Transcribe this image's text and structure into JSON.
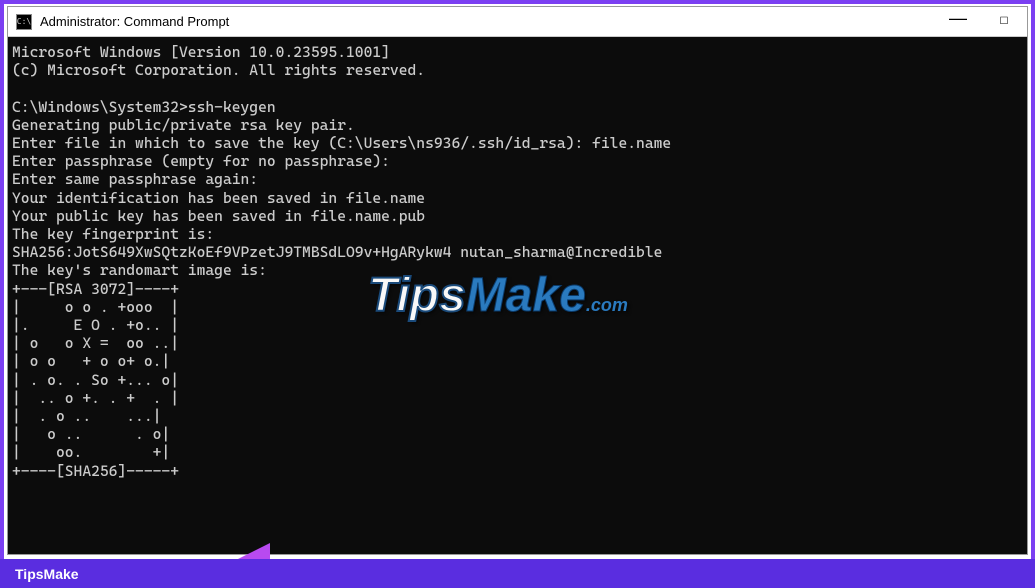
{
  "window": {
    "title": "Administrator: Command Prompt",
    "icon_label": "C:\\"
  },
  "terminal": {
    "line1": "Microsoft Windows [Version 10.0.23595.1001]",
    "line2": "(c) Microsoft Corporation. All rights reserved.",
    "line3": "",
    "line4": "C:\\Windows\\System32>ssh-keygen",
    "line5": "Generating public/private rsa key pair.",
    "line6": "Enter file in which to save the key (C:\\Users\\ns936/.ssh/id_rsa): file.name",
    "line7": "Enter passphrase (empty for no passphrase):",
    "line8": "Enter same passphrase again:",
    "line9": "Your identification has been saved in file.name",
    "line10": "Your public key has been saved in file.name.pub",
    "line11": "The key fingerprint is:",
    "line12": "SHA256:JotS649XwSQtzKoEf9VPzetJ9TMBSdLO9v+HgARykw4 nutan_sharma@Incredible",
    "line13": "The key's randomart image is:",
    "line14": "+---[RSA 3072]----+",
    "line15": "|     o o . +ooo  |",
    "line16": "|.     E O . +o.. |",
    "line17": "| o   o X =  oo ..|",
    "line18": "| o o   + o o+ o.|",
    "line19": "| . o. . So +... o|",
    "line20": "|  .. o +. . +  . |",
    "line21": "|  . o ..    ...|",
    "line22": "|   o ..      . o|",
    "line23": "|    oo.        +|",
    "line24": "+----[SHA256]-----+",
    "line25": ""
  },
  "watermark": {
    "part1": "Tips",
    "part2": "Make",
    "part3": ".com"
  },
  "footer": {
    "text": "TipsMake"
  }
}
